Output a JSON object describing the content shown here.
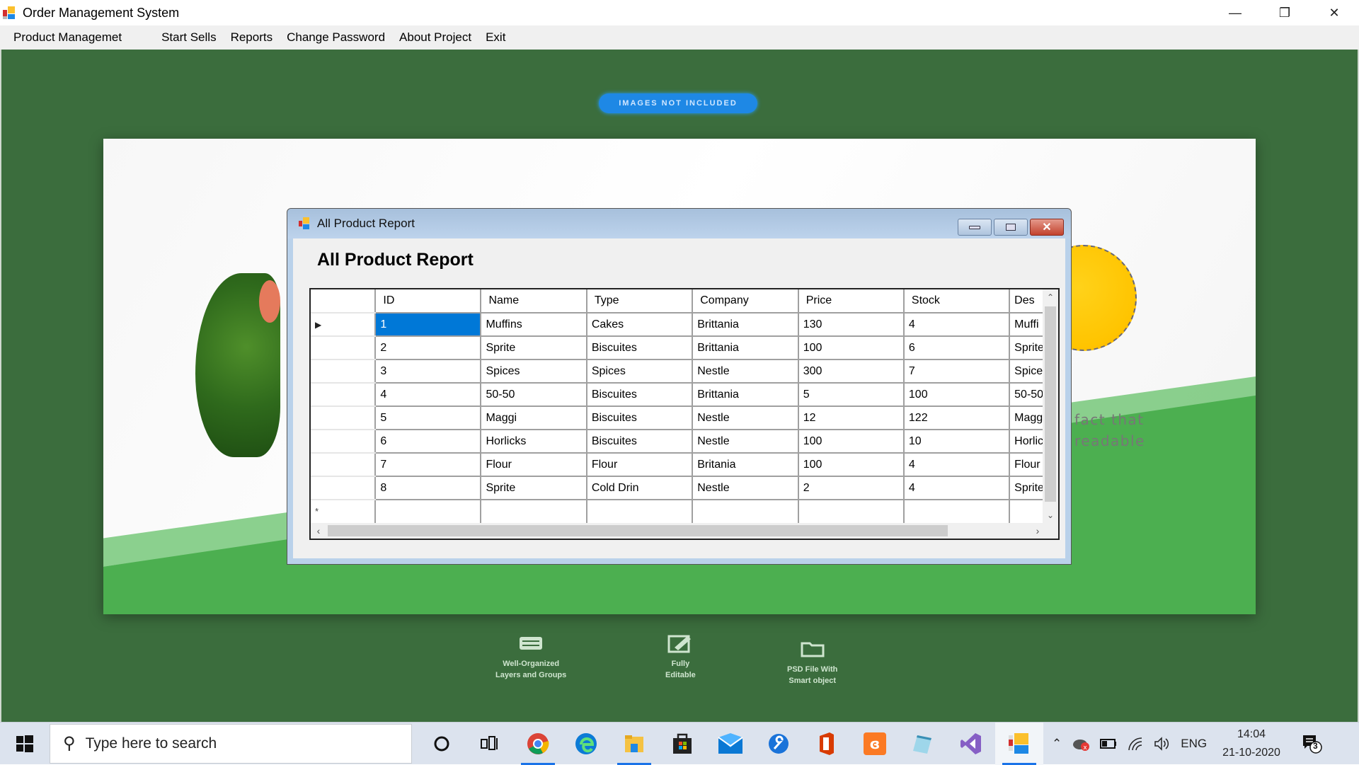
{
  "window": {
    "title": "Order Management System",
    "controls": {
      "minimize": "—",
      "restore": "❐",
      "close": "✕"
    }
  },
  "menubar": {
    "items": [
      "Product Managemet",
      "Start Sells",
      "Reports",
      "Change Password",
      "About Project",
      "Exit"
    ]
  },
  "background": {
    "badge": "IMAGES NOT INCLUDED",
    "hero_text_line1": "fact that",
    "hero_text_line2": "readable",
    "features": [
      {
        "icon": "layers-icon",
        "line1": "Well-Organized",
        "line2": "Layers and Groups"
      },
      {
        "icon": "edit-icon",
        "line1": "Fully",
        "line2": "Editable"
      },
      {
        "icon": "folder-icon",
        "line1": "PSD File With",
        "line2": "Smart object"
      }
    ]
  },
  "dialog": {
    "title": "All Product Report",
    "heading": "All Product Report",
    "controls": {
      "close": "✕"
    },
    "grid": {
      "columns": [
        "ID",
        "Name",
        "Type",
        "Company",
        "Price",
        "Stock",
        "Des"
      ],
      "rows": [
        [
          "1",
          "Muffins",
          "Cakes",
          "Brittania",
          "130",
          "4",
          "Muffi"
        ],
        [
          "2",
          "Sprite",
          "Biscuites",
          "Brittania",
          "100",
          "6",
          "Sprite"
        ],
        [
          "3",
          "Spices",
          "Spices",
          "Nestle",
          "300",
          "7",
          "Spice"
        ],
        [
          "4",
          "50-50",
          "Biscuites",
          "Brittania",
          "5",
          "100",
          "50-50"
        ],
        [
          "5",
          "Maggi",
          "Biscuites",
          "Nestle",
          "12",
          "122",
          "Magg"
        ],
        [
          "6",
          "Horlicks",
          "Biscuites",
          "Nestle",
          "100",
          "10",
          "Horlic"
        ],
        [
          "7",
          "Flour",
          "Flour",
          "Britania",
          "100",
          "4",
          "Flour"
        ],
        [
          "8",
          "Sprite",
          "Cold Drin",
          "Nestle",
          "2",
          "4",
          "Sprite"
        ]
      ],
      "selected_row_indicator": "▶",
      "new_row_indicator": "*",
      "selected_cell": {
        "row": 0,
        "col": 0
      }
    }
  },
  "taskbar": {
    "search_placeholder": "Type here to search",
    "tray": {
      "language": "ENG",
      "time": "14:04",
      "date": "21-10-2020",
      "notifications": "3"
    }
  },
  "colors": {
    "selection": "#0078d7",
    "background_green": "#3b6d3d",
    "badge_blue": "#1e88e5"
  }
}
